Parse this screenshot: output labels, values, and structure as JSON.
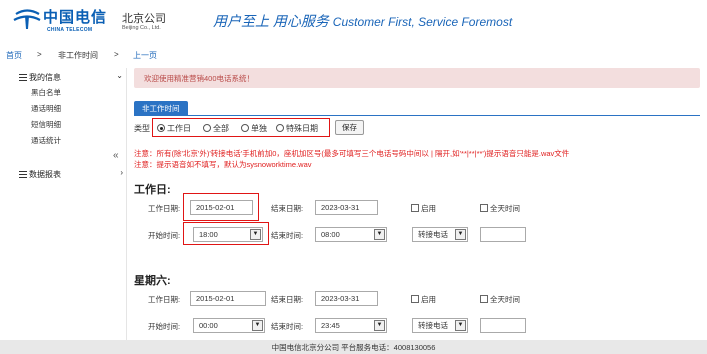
{
  "header": {
    "logo_cn": "中国电信",
    "logo_en": "CHINA TELECOM",
    "branch_cn": "北京公司",
    "branch_en": "Beijing Co., Ltd.",
    "slogan_cn": "用户至上 用心服务",
    "slogan_en": "Customer First, Service Foremost",
    "brand_color": "#0a5fb4"
  },
  "breadcrumb": {
    "home": "首页",
    "sep1": ">",
    "current": "非工作时间",
    "sep2": ">",
    "back": "上一页"
  },
  "sidebar": {
    "groups": [
      {
        "label": "我的信息",
        "icon": "list-icon",
        "chevron": "⌄",
        "items": [
          "黑白名单",
          "通话明细",
          "短信明细",
          "通话统计"
        ]
      },
      {
        "label": "数据报表",
        "icon": "list-icon",
        "chevron": "›",
        "items": []
      }
    ],
    "collapse_icon": "«"
  },
  "main": {
    "welcome": "欢迎使用精准营销400电话系统！",
    "tab": "非工作时间",
    "type_label": "类型",
    "type_options": [
      "工作日",
      "全部",
      "单独",
      "特殊日期"
    ],
    "type_selected": "工作日",
    "save_label": "保存",
    "notice1": "注意：所有(除'北京'外)'转接电话'手机前加0，座机加区号(最多可填写三个电话号码中间以 | 隔开,如'**|**|**')提示语音只能是.wav文件",
    "notice2": "注意：提示语音如不填写，默认为sysnoworktime.wav",
    "sections": [
      {
        "title": "工作日:",
        "work_date_label": "工作日期:",
        "work_date": "2015-02-01",
        "end_date_label": "结束日期:",
        "end_date": "2023-03-31",
        "enable_label": "启用",
        "allday_label": "全天时间",
        "start_time_label": "开始时间:",
        "start_time": "18:00",
        "end_time_label": "结束时间:",
        "end_time": "08:00",
        "transfer_option": "转接电话",
        "transfer_value": ""
      },
      {
        "title": "星期六:",
        "work_date_label": "工作日期:",
        "work_date": "2015-02-01",
        "end_date_label": "结束日期:",
        "end_date": "2023-03-31",
        "enable_label": "启用",
        "allday_label": "全天时间",
        "start_time_label": "开始时间:",
        "start_time": "00:00",
        "end_time_label": "结束时间:",
        "end_time": "23:45",
        "transfer_option": "转接电话",
        "transfer_value": ""
      }
    ]
  },
  "footer": "中国电信北京分公司 平台服务电话：4008130056",
  "colors": {
    "accent": "#2b73c4",
    "notice": "#e02020",
    "highlight_box": "#e01515",
    "welcome_bg": "#f3dede"
  }
}
